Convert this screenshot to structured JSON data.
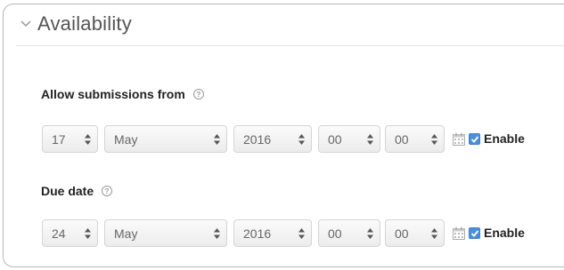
{
  "section": {
    "title": "Availability"
  },
  "fields": [
    {
      "label": "Allow submissions from",
      "day": "17",
      "month": "May",
      "year": "2016",
      "hour": "00",
      "minute": "00",
      "enabled": true,
      "enable_label": "Enable"
    },
    {
      "label": "Due date",
      "day": "24",
      "month": "May",
      "year": "2016",
      "hour": "00",
      "minute": "00",
      "enabled": true,
      "enable_label": "Enable"
    }
  ],
  "icons": {
    "collapse": "chevron-down-icon",
    "help": "help-icon",
    "calendar": "calendar-icon",
    "checkbox": "checkbox-checked-icon"
  },
  "colors": {
    "checkbox": "#4a90d9"
  }
}
